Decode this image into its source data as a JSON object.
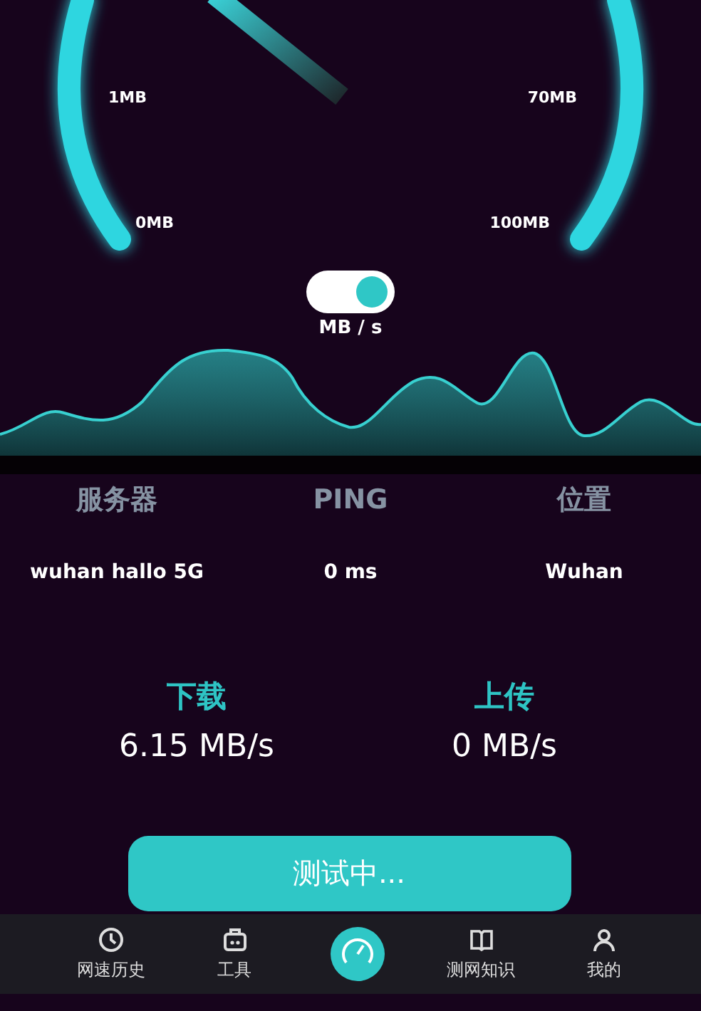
{
  "gauge": {
    "left_labels": [
      "1MB",
      "0MB"
    ],
    "right_labels": [
      "70MB",
      "100MB"
    ]
  },
  "unit_toggle": {
    "on": true,
    "label": "MB / s"
  },
  "info": {
    "columns": [
      {
        "header": "服务器",
        "value": "wuhan hallo 5G"
      },
      {
        "header": "PING",
        "value": "0 ms"
      },
      {
        "header": "位置",
        "value": "Wuhan"
      }
    ]
  },
  "speeds": [
    {
      "label": "下载",
      "value": "6.15 MB/s"
    },
    {
      "label": "上传",
      "value": "0 MB/s"
    }
  ],
  "action_button": {
    "label": "测试中..."
  },
  "bottom_nav": [
    {
      "kind": "tab",
      "label": "网速历史"
    },
    {
      "kind": "tab",
      "label": "工具"
    },
    {
      "kind": "center"
    },
    {
      "kind": "tab",
      "label": "测网知识"
    },
    {
      "kind": "tab",
      "label": "我的"
    }
  ]
}
